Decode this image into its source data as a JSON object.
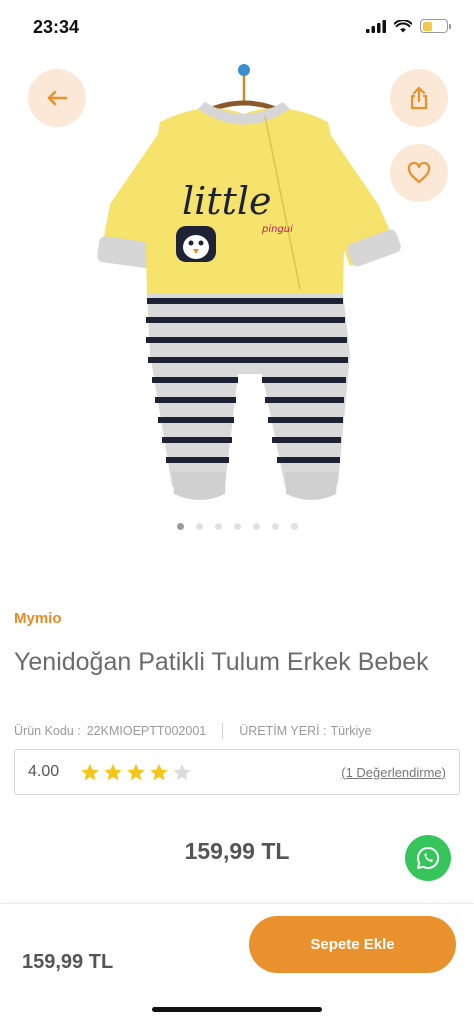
{
  "status_bar": {
    "time": "23:34",
    "battery_level": 0.42
  },
  "icons": {
    "back": "arrow-left-icon",
    "share": "share-icon",
    "favorite": "heart-icon",
    "star": "star-icon",
    "whatsapp": "whatsapp-icon"
  },
  "colors": {
    "accent": "#e8912d",
    "accent_light": "#fbe8d6",
    "brand": "#e88b22",
    "star_filled": "#f5c518",
    "star_empty": "#dcdcdc",
    "whatsapp": "#35c55b"
  },
  "gallery": {
    "image_count": 7,
    "active_index": 0
  },
  "product": {
    "brand": "Mymio",
    "title": "Yenidoğan Patikli Tulum Erkek Bebek",
    "code_label": "Ürün Kodu :",
    "code_value": "22KMIOEPTT002001",
    "origin_label": "ÜRETİM YERİ :",
    "origin_value": "Türkiye",
    "garment_print": {
      "word": "little",
      "sub": "pingui"
    }
  },
  "rating": {
    "value": "4.00",
    "stars": 4,
    "max_stars": 5,
    "reviews_link": "(1 Değerlendirme)"
  },
  "price": "159,99 TL",
  "bottom_bar": {
    "price": "159,99 TL",
    "add_to_cart": "Sepete Ekle"
  }
}
